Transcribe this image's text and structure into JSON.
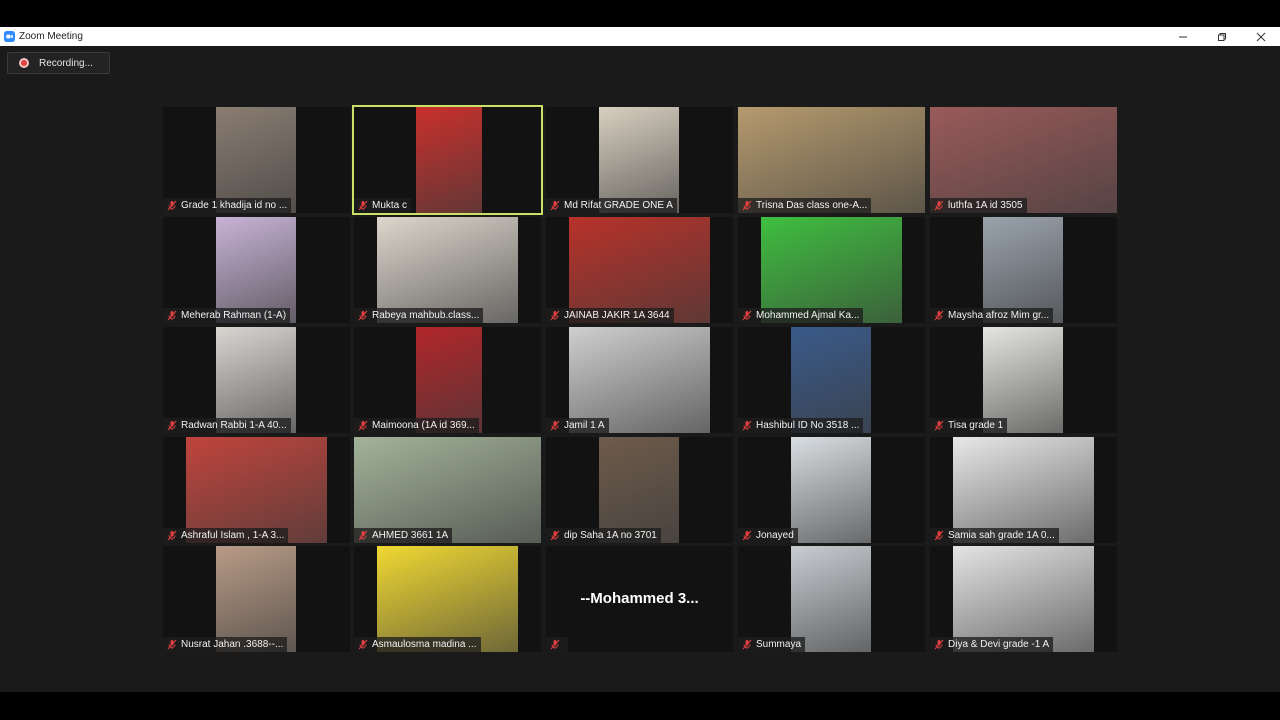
{
  "window": {
    "title": "Zoom Meeting"
  },
  "recording": {
    "label": "Recording..."
  },
  "colors": {
    "active_speaker": "#c9e265",
    "mute": "#e04040",
    "rec": "#e04040"
  },
  "participants": [
    {
      "name": "Grade 1 khadija id no ...",
      "muted": true
    },
    {
      "name": "Mukta c",
      "muted": true,
      "active": true
    },
    {
      "name": "Md Rifat GRADE ONE A",
      "muted": true
    },
    {
      "name": "Trisna Das class one-A...",
      "muted": true
    },
    {
      "name": "luthfa 1A id 3505",
      "muted": true
    },
    {
      "name": "Meherab Rahman (1-A)",
      "muted": true
    },
    {
      "name": "Rabeya mahbub.class...",
      "muted": true
    },
    {
      "name": "JAINAB JAKIR 1A 3644",
      "muted": true
    },
    {
      "name": "Mohammed Ajmal Ka...",
      "muted": true
    },
    {
      "name": "Maysha afroz Mim  gr...",
      "muted": true
    },
    {
      "name": "Radwan Rabbi 1-A 40...",
      "muted": true
    },
    {
      "name": "Maimoona (1A id 369...",
      "muted": true
    },
    {
      "name": "Jamil 1 A",
      "muted": true
    },
    {
      "name": "Hashibul ID No 3518 ...",
      "muted": true
    },
    {
      "name": "Tisa grade 1",
      "muted": true
    },
    {
      "name": "Ashraful Islam , 1-A  3...",
      "muted": true
    },
    {
      "name": "AHMED 3661 1A",
      "muted": true
    },
    {
      "name": "dip Saha 1A no   3701",
      "muted": true
    },
    {
      "name": "Jonayed",
      "muted": true
    },
    {
      "name": "Samia sah grade 1A 0...",
      "muted": true
    },
    {
      "name": "Nusrat Jahan .3688--...",
      "muted": true
    },
    {
      "name": "Asmaulosma madina ...",
      "muted": true
    },
    {
      "name": "",
      "muted": true,
      "video_off_name": "--Mohammed  3..."
    },
    {
      "name": "Summaya",
      "muted": true
    },
    {
      "name": "Diya & Devi grade -1 A",
      "muted": true
    }
  ]
}
